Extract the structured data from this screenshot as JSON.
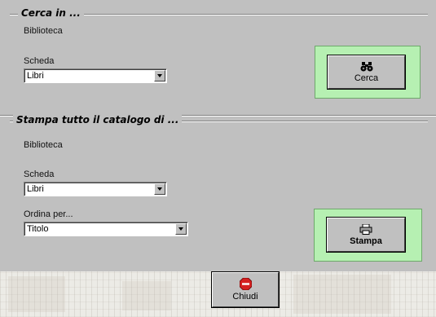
{
  "search_section": {
    "title": "Cerca in ...",
    "library_label": "Biblioteca",
    "card_label": "Scheda",
    "card_value": "Libri",
    "search_button": {
      "label": "Cerca",
      "icon": "binoculars-icon"
    }
  },
  "print_section": {
    "title": "Stampa tutto il catalogo di ...",
    "library_label": "Biblioteca",
    "card_label": "Scheda",
    "card_value": "Libri",
    "order_label": "Ordina per...",
    "order_value": "Titolo",
    "print_button": {
      "label": "Stampa",
      "icon": "printer-icon"
    }
  },
  "footer": {
    "close_button": {
      "label": "Chiudi",
      "icon": "stop-icon"
    }
  },
  "colors": {
    "form_background": "#c0c0c0",
    "button_highlight": "#b6f0b2",
    "close_icon": "#d42020"
  }
}
